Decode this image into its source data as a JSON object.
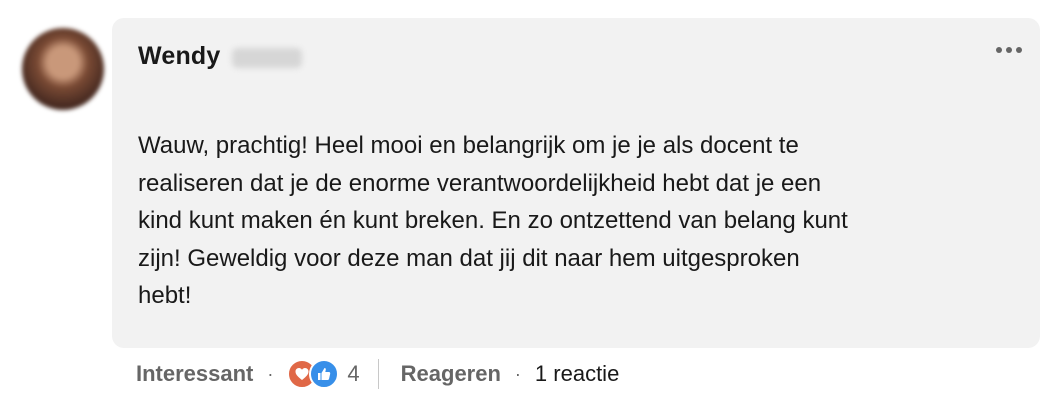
{
  "comment": {
    "author_first_name": "Wendy",
    "text": "Wauw, prachtig! Heel mooi en belangrijk om je je als docent te\nrealiseren dat je de enorme verantwoordelijkheid hebt dat je een\nkind kunt maken én kunt breken. En zo ontzettend van belang kunt\nzijn! Geweldig voor deze man dat jij dit naar hem uitgesproken\nhebt!"
  },
  "actions": {
    "react_label": "Interessant",
    "reaction_count": "4",
    "reaction_icons": [
      "insightful-icon",
      "like-icon"
    ],
    "reply_label": "Reageren",
    "replies_label": "1 reactie"
  },
  "colors": {
    "bubble": "#f2f2f2",
    "insightful": "#e06847",
    "like": "#378fe9",
    "muted": "#666666"
  }
}
